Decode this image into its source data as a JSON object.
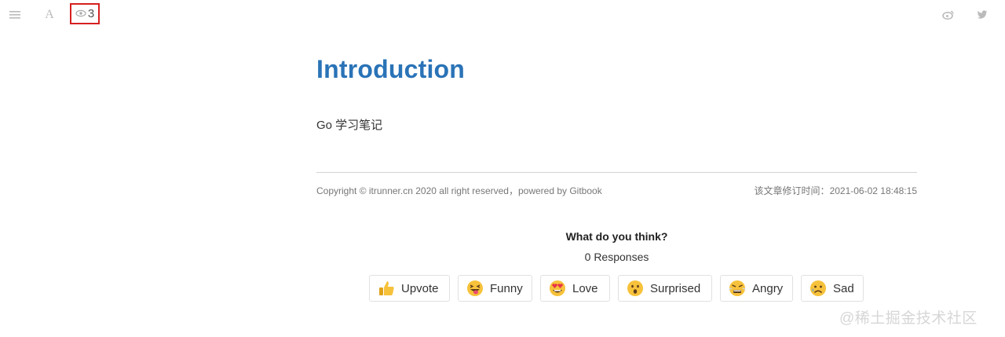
{
  "toolbar": {
    "menu_icon": "hamburger-menu-icon",
    "font_icon": "font-settings-icon",
    "font_glyph": "A",
    "views_icon": "eye-icon",
    "views_count": "3",
    "weibo_icon": "weibo-icon",
    "twitter_icon": "twitter-icon"
  },
  "page": {
    "title": "Introduction",
    "text": "Go 学习笔记"
  },
  "footer": {
    "copyright": "Copyright © itrunner.cn 2020 all right reserved，powered by Gitbook",
    "updated_label": "该文章修订时间：",
    "updated_time": "2021-06-02 18:48:15"
  },
  "reactions": {
    "question": "What do you think?",
    "responses": "0 Responses",
    "buttons": [
      {
        "label": "Upvote",
        "icon": "thumbs-up-emoji"
      },
      {
        "label": "Funny",
        "icon": "tongue-out-emoji"
      },
      {
        "label": "Love",
        "icon": "heart-eyes-emoji"
      },
      {
        "label": "Surprised",
        "icon": "surprised-emoji"
      },
      {
        "label": "Angry",
        "icon": "angry-emoji"
      },
      {
        "label": "Sad",
        "icon": "sad-emoji"
      }
    ]
  },
  "watermark": "@稀土掘金技术社区",
  "colors": {
    "title": "#2a73b7",
    "highlight_box": "#d62020"
  }
}
